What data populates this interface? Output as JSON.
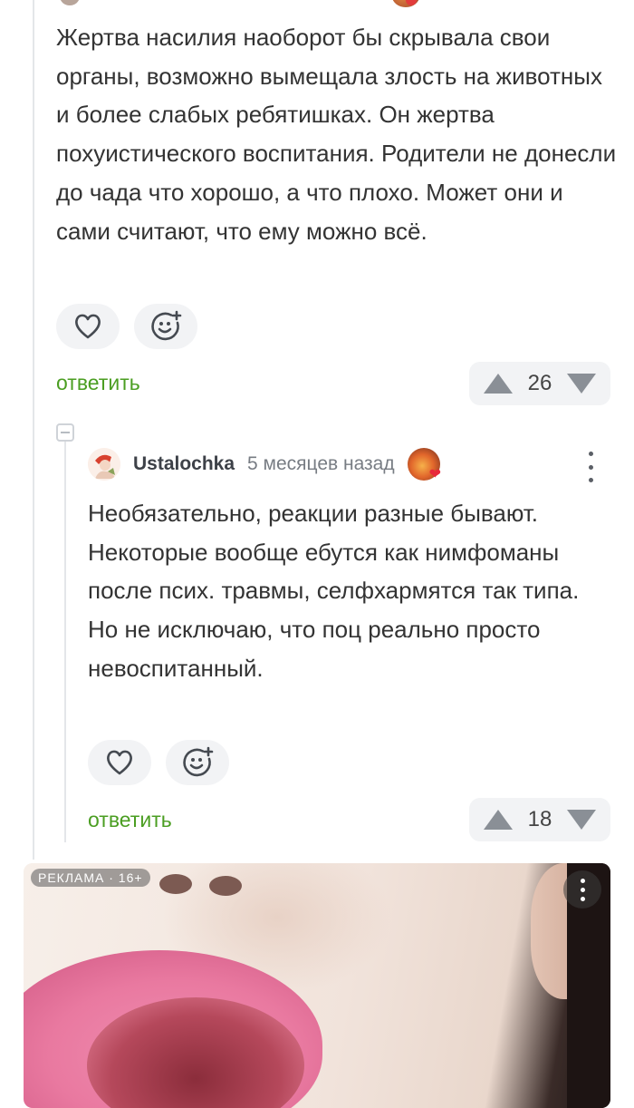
{
  "comment1": {
    "text": "Жертва насилия наоборот бы скрывала свои органы, возможно вымещала злость на животных и более слабых ребятишках. Он жертва похуистического воспитания. Родители не донесли до чада что хорошо, а что плохо. Может они и сами считают, что ему можно всё.",
    "reply_label": "ответить",
    "rating": "26",
    "icons": {
      "like": "heart-icon",
      "react": "emoji-add-icon",
      "up": "arrow-up-icon",
      "down": "arrow-down-icon"
    }
  },
  "comment2": {
    "author": "Ustalochka",
    "time": "5 месяцев назад",
    "text": "Необязательно, реакции разные бывают. Некоторые вообще ебутся как нимфоманы после псих. травмы, селфхармятся так типа.\nНо не исключаю, что поц реально просто невоспитанный.",
    "reply_label": "ответить",
    "rating": "18"
  },
  "ad": {
    "label": "РЕКЛАМА · 16+"
  },
  "colors": {
    "accent_green": "#4b9e22",
    "pill_bg": "#f2f3f5",
    "icon_gray": "#8a8f96"
  }
}
